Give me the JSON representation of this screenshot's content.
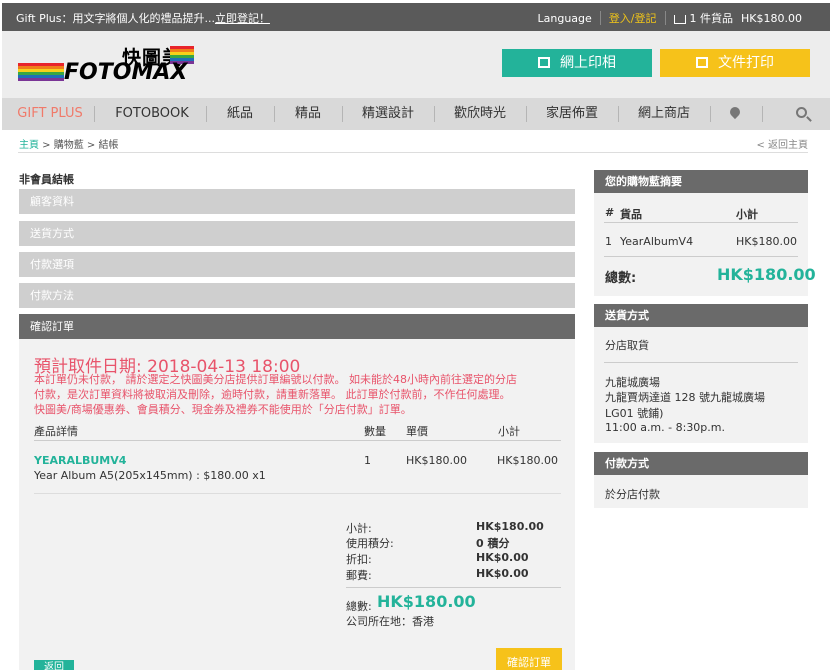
{
  "topbar": {
    "promo_text": "Gift Plus：用文字將個人化的禮品提升...",
    "promo_link": "立即登記！",
    "language": "Language",
    "login": "登入/登記",
    "cart": "1 件貨品",
    "cart_total": "HK$180.00"
  },
  "header": {
    "logo_cn": "快圖美",
    "logo_en": "FOTOMAX",
    "photo_print_button": "網上印相",
    "document_print_button": "文件打印"
  },
  "nav": {
    "items": [
      "GIFT PLUS",
      "FOTOBOOK",
      "紙品",
      "精品",
      "精選設計",
      "歡欣時光",
      "家居佈置",
      "網上商店"
    ]
  },
  "breadcrumb": {
    "home": "主頁",
    "cart": "購物藍",
    "checkout": "結帳",
    "back_home": "< 返回主頁"
  },
  "checkout": {
    "title": "非會員結帳",
    "steps": [
      "顧客資料",
      "送貨方式",
      "付款選項",
      "付款方法",
      "確認訂單"
    ],
    "pickup_date": "預計取件日期: 2018-04-13 18:00",
    "warning_lines": [
      "本訂單仍未付款， 請於選定之快圖美分店提供訂單編號以付款。 如未能於48小時內前往選定的分店",
      "付款，是次訂單資料將被取消及刪除，逾時付款，請重新落單。 此訂單於付款前，不作任何處理。",
      "快圖美/商場優惠券、會員積分、現金券及禮券不能使用於「分店付款」訂單。"
    ],
    "table": {
      "headers": [
        "產品詳情",
        "數量",
        "單價",
        "小計"
      ],
      "row": {
        "name": "YEARALBUMV4",
        "desc": "Year Album A5(205x145mm) : $180.00 x1",
        "qty": "1",
        "unit_price": "HK$180.00",
        "subtotal": "HK$180.00"
      }
    },
    "summary": {
      "subtotal_label": "小計:",
      "subtotal": "HK$180.00",
      "points_label": "使用積分:",
      "points": "0 積分",
      "discount_label": "折扣:",
      "discount": "HK$0.00",
      "shipping_label": "郵費:",
      "shipping": "HK$0.00",
      "total_label": "總數:",
      "total": "HK$180.00",
      "company_label": "公司所在地：香港"
    },
    "back_button": "返回",
    "confirm_button": "確認訂單"
  },
  "sidebar": {
    "cart_summary": {
      "title": "您的購物藍摘要",
      "col_no": "#",
      "col_item": "貨品",
      "col_subtotal": "小計",
      "row_no": "1",
      "row_item": "YearAlbumV4",
      "row_subtotal": "HK$180.00",
      "total_label": "總數:",
      "total": "HK$180.00"
    },
    "shipping": {
      "title": "送貨方式",
      "method": "分店取貨",
      "store_name": "九龍城廣場",
      "address1": "九龍賈炳達道 128 號九龍城廣場",
      "address2": "LG01 號鋪)",
      "hours": "11:00 a.m. - 8:30p.m."
    },
    "payment": {
      "title": "付款方式",
      "method": "於分店付款"
    }
  }
}
